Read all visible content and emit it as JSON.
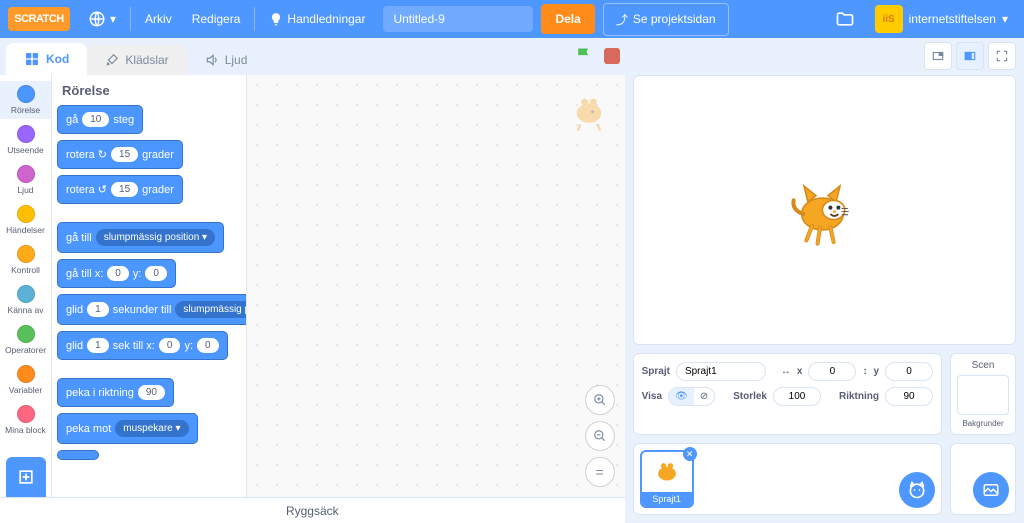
{
  "menubar": {
    "logo_text": "SCRATCH",
    "file": "Arkiv",
    "edit": "Redigera",
    "tutorials": "Handledningar",
    "project_title": "Untitled-9",
    "share": "Dela",
    "see_project": "Se projektsidan",
    "username": "internetstiftelsen",
    "avatar_text": "iiS"
  },
  "tabs": {
    "code": "Kod",
    "costumes": "Klädslar",
    "sounds": "Ljud"
  },
  "categories": [
    {
      "name": "Rörelse",
      "color": "#4c97ff"
    },
    {
      "name": "Utseende",
      "color": "#9966ff"
    },
    {
      "name": "Ljud",
      "color": "#cf63cf"
    },
    {
      "name": "Händelser",
      "color": "#ffbf00"
    },
    {
      "name": "Kontroll",
      "color": "#ffab19"
    },
    {
      "name": "Känna av",
      "color": "#5cb1d6"
    },
    {
      "name": "Operatorer",
      "color": "#59c059"
    },
    {
      "name": "Variabler",
      "color": "#ff8c1a"
    },
    {
      "name": "Mina block",
      "color": "#ff6680"
    }
  ],
  "palette": {
    "header": "Rörelse",
    "b_move_a": "gå",
    "b_move_v": "10",
    "b_move_b": "steg",
    "b_rot_cw_a": "rotera ↻",
    "b_rot_cw_v": "15",
    "b_rot_cw_b": "grader",
    "b_rot_ccw_a": "rotera ↺",
    "b_rot_ccw_v": "15",
    "b_rot_ccw_b": "grader",
    "b_goto_a": "gå till",
    "b_goto_dd": "slumpmässig position ▾",
    "b_gotoxy_a": "gå till x:",
    "b_gotoxy_x": "0",
    "b_gotoxy_b": "y:",
    "b_gotoxy_y": "0",
    "b_glide_a": "glid",
    "b_glide_v": "1",
    "b_glide_b": "sekunder till",
    "b_glide_dd": "slumpmässig positio",
    "b_glidexy_a": "glid",
    "b_glidexy_v": "1",
    "b_glidexy_b": "sek till x:",
    "b_glidexy_x": "0",
    "b_glidexy_c": "y:",
    "b_glidexy_y": "0",
    "b_point_a": "peka i riktning",
    "b_point_v": "90",
    "b_pointto_a": "peka mot",
    "b_pointto_dd": "muspekare ▾"
  },
  "backpack": "Ryggsäck",
  "sprite_info": {
    "sprite_label": "Sprajt",
    "sprite_name": "Sprajt1",
    "x_label": "x",
    "x_val": "0",
    "y_label": "y",
    "y_val": "0",
    "show_label": "Visa",
    "size_label": "Storlek",
    "size_val": "100",
    "dir_label": "Riktning",
    "dir_val": "90",
    "stage_label": "Scen",
    "backdrops_label": "Bakgrunder"
  },
  "sprite_tile_name": "Sprajt1"
}
